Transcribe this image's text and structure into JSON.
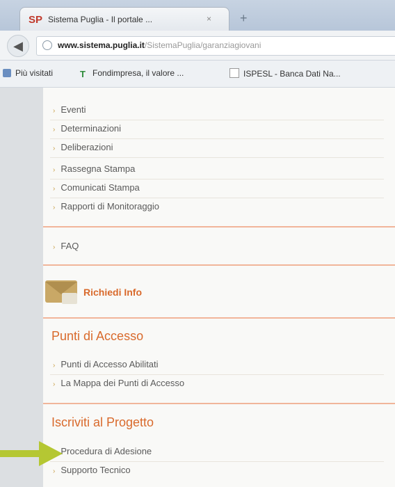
{
  "browser": {
    "tab_title": "Sistema Puglia - Il portale ...",
    "tab_favicon": "SP",
    "tab_close": "×",
    "new_tab": "+",
    "back_icon": "back-arrow-icon",
    "url_host": "www.sistema.puglia.it",
    "url_path": "/SistemaPuglia/garanziagiovani",
    "bookmarks": [
      {
        "label": "Più visitati",
        "icon": "star-icon"
      },
      {
        "label": "Fondimpresa, il valore ...",
        "icon": "fondimpresa-icon"
      },
      {
        "label": "ISPESL - Banca Dati Na...",
        "icon": "page-icon"
      }
    ]
  },
  "menu": {
    "items": [
      "Eventi",
      "Determinazioni",
      "Deliberazioni",
      "Rassegna Stampa",
      "Comunicati Stampa",
      "Rapporti di Monitoraggio"
    ],
    "faq": "FAQ"
  },
  "info": {
    "label": "Richiedi Info"
  },
  "accesso": {
    "title": "Punti di Accesso",
    "items": [
      "Punti di Accesso Abilitati",
      "La Mappa dei Punti di Accesso"
    ]
  },
  "progetto": {
    "title": "Iscriviti al Progetto",
    "items": [
      "Procedura di Adesione",
      "Supporto Tecnico"
    ]
  },
  "colors": {
    "accent": "#d96a2c",
    "divider": "#f1b59a",
    "arrow": "#b5c733"
  }
}
